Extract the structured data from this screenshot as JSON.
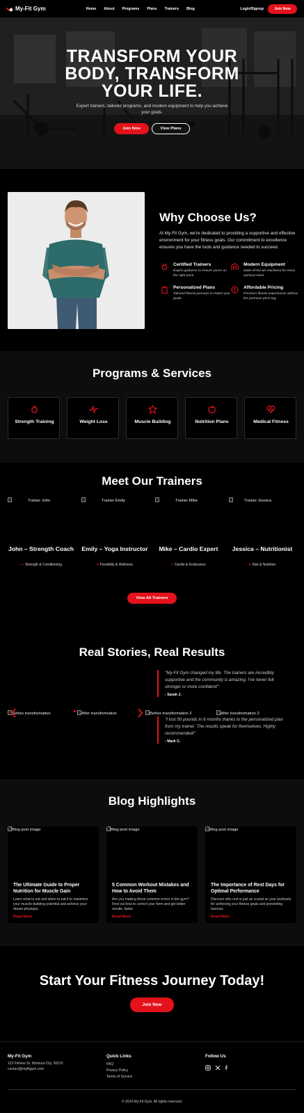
{
  "nav": {
    "brand": "My-Fit Gym",
    "links": [
      "Home",
      "About",
      "Programs",
      "Plans",
      "Trainers",
      "Blog"
    ],
    "login": "Login/Signup",
    "join": "Join Now"
  },
  "hero": {
    "title_lines": [
      "TRANSFORM YOUR",
      "BODY, TRANSFORM",
      "YOUR LIFE."
    ],
    "subtitle": "Expert trainers, tailored programs, and modern equipment to help you achieve your goals.",
    "primary_button": "Join Now",
    "secondary_button": "View Plans"
  },
  "why": {
    "title": "Why Choose Us?",
    "text": "At My-Fit Gym, we're dedicated to providing a supportive and effective environment for your fitness goals. Our commitment to excellence ensures you have the tools and guidance needed to succeed.",
    "features": [
      {
        "title": "Certified Trainers",
        "desc": "Expert guidance to ensure you're on the right track.",
        "icon": "medal-icon"
      },
      {
        "title": "Modern Equipment",
        "desc": "State-of-the-art machines for every workout need.",
        "icon": "equipment-icon"
      },
      {
        "title": "Personalized Plans",
        "desc": "Tailored fitness journeys to match your goals.",
        "icon": "clipboard-icon"
      },
      {
        "title": "Affordable Pricing",
        "desc": "Premium fitness experiences without the premium price tag.",
        "icon": "price-icon"
      }
    ]
  },
  "programs": {
    "title": "Programs & Services",
    "items": [
      {
        "label": "Strength Training",
        "icon": "strength-icon"
      },
      {
        "label": "Weight Loss",
        "icon": "pulse-icon"
      },
      {
        "label": "Muscle Building",
        "icon": "muscle-icon"
      },
      {
        "label": "Nutrition Plans",
        "icon": "apple-icon"
      },
      {
        "label": "Medical Fitness",
        "icon": "heart-pulse-icon"
      }
    ]
  },
  "trainers": {
    "title": "Meet Our Trainers",
    "items": [
      {
        "image_alt": "Trainer John",
        "name": "John – Strength Coach",
        "spec": "Strength & Conditioning",
        "icon": "dumbbell-icon"
      },
      {
        "image_alt": "Trainer Emily",
        "name": "Emily – Yoga Instructor",
        "spec": "Flexibility & Wellness",
        "icon": "heart-icon"
      },
      {
        "image_alt": "Trainer Mike",
        "name": "Mike – Cardio Expert",
        "spec": "Cardio & Endurance",
        "icon": "running-icon"
      },
      {
        "image_alt": "Trainer Jessica",
        "name": "Jessica – Nutritionist",
        "spec": "Diet & Nutrition",
        "icon": "apple-icon"
      }
    ],
    "button": "View All Trainers"
  },
  "stories": {
    "title": "Real Stories, Real Results",
    "images": [
      "Before transformation",
      "After transformation",
      "Before transformation 2",
      "After transformation 2"
    ],
    "quotes": [
      {
        "text": "\"My-Fit Gym changed my life. The trainers are incredibly supportive and the community is amazing. I've never felt stronger or more confident!\"",
        "author": "- Sarah J."
      },
      {
        "text": "\"I lost 50 pounds in 6 months thanks to the personalized plan from my trainer. The results speak for themselves. Highly recommended!\"",
        "author": "- Mark C."
      }
    ]
  },
  "blog": {
    "title": "Blog Highlights",
    "posts": [
      {
        "image_alt": "Blog post image",
        "title": "The Ultimate Guide to Proper Nutrition for Muscle Gain",
        "excerpt": "Learn what to eat and when to eat it to maximize your muscle-building potential and achieve your dream physique.",
        "link": "Read More →"
      },
      {
        "image_alt": "Blog post image",
        "title": "5 Common Workout Mistakes and How to Avoid Them",
        "excerpt": "Are you making these common errors in the gym? Find out how to correct your form and get better results, faster.",
        "link": "Read More →"
      },
      {
        "image_alt": "Blog post image",
        "title": "The Importance of Rest Days for Optimal Performance",
        "excerpt": "Discover why rest is just as crucial as your workouts for achieving your fitness goals and preventing burnout.",
        "link": "Read More →"
      }
    ]
  },
  "cta": {
    "title": "Start Your Fitness Journey Today!",
    "button": "Join Now"
  },
  "footer": {
    "brand": "My-Fit Gym",
    "address": "123 Fitness St, Workout City, 90210",
    "email": "contact@myfitgym.com",
    "quick_links_title": "Quick Links",
    "links": [
      "FAQ",
      "Privacy Policy",
      "Terms of Service"
    ],
    "follow_title": "Follow Us",
    "copyright": "© 2024 My-Fit Gym. All rights reserved."
  },
  "colors": {
    "accent": "#e3121b",
    "background": "#000000",
    "section_alt": "#0d0d0d"
  }
}
